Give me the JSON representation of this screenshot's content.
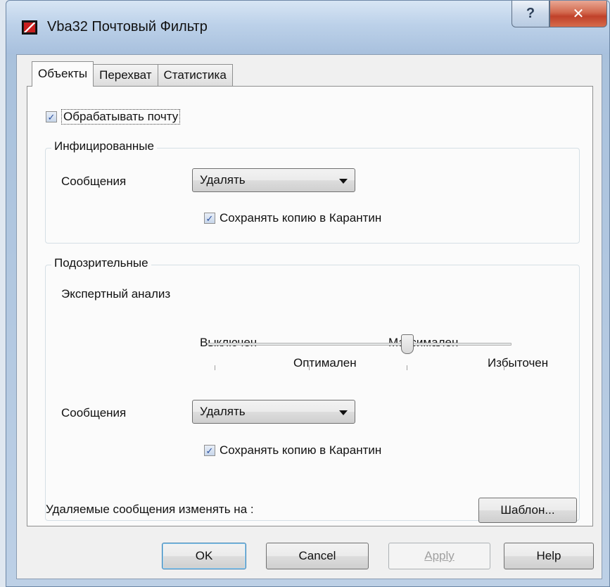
{
  "window": {
    "title": "Vba32 Почтовый Фильтр",
    "help_glyph": "?",
    "close_glyph": "✕"
  },
  "tabs": [
    {
      "label": "Объекты",
      "active": true
    },
    {
      "label": "Перехват",
      "active": false
    },
    {
      "label": "Статистика",
      "active": false
    }
  ],
  "process_mail": {
    "label": "Обрабатывать почту",
    "checked": true
  },
  "infected": {
    "title": "Инфицированные",
    "messages_label": "Сообщения",
    "action": "Удалять",
    "save_copy": {
      "label": "Сохранять копию в Карантин",
      "checked": true
    }
  },
  "suspicious": {
    "title": "Подозрительные",
    "expert_label": "Экспертный анализ",
    "slider_levels": [
      "Выключен",
      "Оптимален",
      "Максимален",
      "Избыточен"
    ],
    "slider_value": "Максимален",
    "messages_label": "Сообщения",
    "action": "Удалять",
    "save_copy": {
      "label": "Сохранять копию в Карантин",
      "checked": true
    }
  },
  "deleted_change_label": "Удаляемые сообщения изменять на :",
  "template_button": "Шаблон...",
  "buttons": {
    "ok": "OK",
    "cancel": "Cancel",
    "apply": "Apply",
    "help": "Help"
  },
  "colors": {
    "accent": "#3c7fb1",
    "close_red": "#c0412a"
  }
}
